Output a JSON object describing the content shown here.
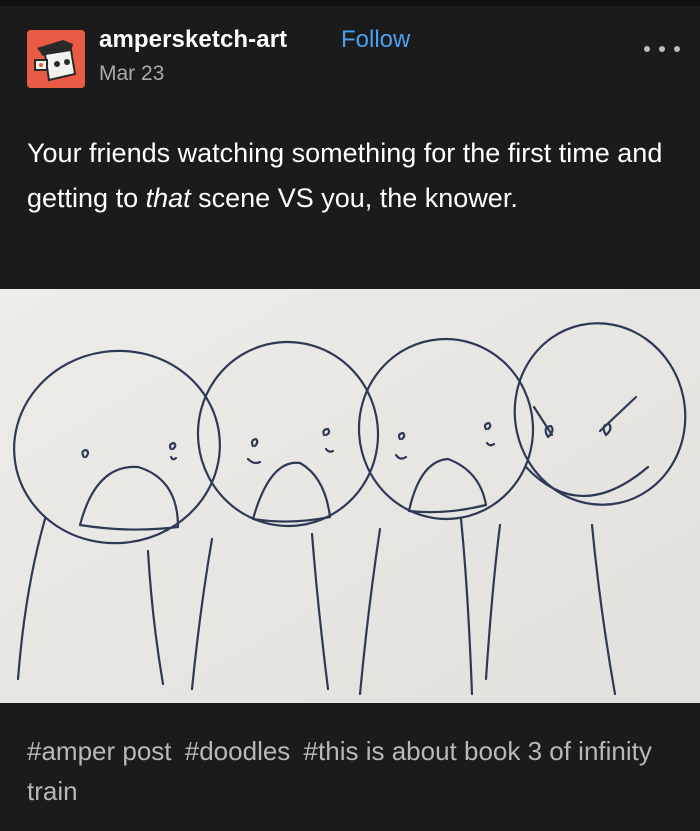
{
  "post": {
    "username": "ampersketch-art",
    "follow_label": "Follow",
    "date": "Mar 23",
    "more_icon": "ellipsis-icon",
    "caption": {
      "part1": "Your friends watching something for the first time and getting to ",
      "emphasis": "that",
      "part2": " scene VS you, the knower."
    },
    "tags": [
      "#amper post",
      "#doodles",
      "#this is about book 3 of infinity train"
    ]
  },
  "colors": {
    "background": "#1b1b1c",
    "follow": "#4a9ff0",
    "avatar": "#e85b45",
    "muted_text": "#a9a9ab",
    "paper": "#ebe9e5",
    "ink": "#2e3a55"
  }
}
